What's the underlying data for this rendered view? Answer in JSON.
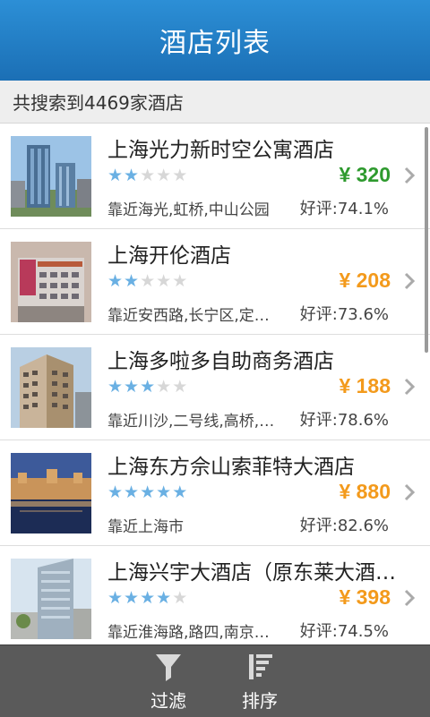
{
  "header": {
    "title": "酒店列表"
  },
  "summary": {
    "text": "共搜索到4469家酒店"
  },
  "hotels": [
    {
      "name": "上海光力新时空公寓酒店",
      "stars": 2,
      "price": "¥ 320",
      "price_color": "#2e9a2e",
      "location": "靠近海光,虹桥,中山公园",
      "rating": "好评:74.1%",
      "thumbnail": "glass-tower"
    },
    {
      "name": "上海开伦酒店",
      "stars": 2,
      "price": "¥ 208",
      "price_color": "#f39a1c",
      "location": "靠近安西路,长宁区,定…",
      "rating": "好评:73.6%",
      "thumbnail": "hotel-facade"
    },
    {
      "name": "上海多啦多自助商务酒店",
      "stars": 3,
      "price": "¥ 188",
      "price_color": "#f39a1c",
      "location": "靠近川沙,二号线,高桥,…",
      "rating": "好评:78.6%",
      "thumbnail": "corner-building"
    },
    {
      "name": "上海东方佘山索菲特大酒店",
      "stars": 5,
      "price": "¥ 880",
      "price_color": "#f39a1c",
      "location": "靠近上海市",
      "rating": "好评:82.6%",
      "thumbnail": "lake-night-resort"
    },
    {
      "name": "上海兴宇大酒店（原东莱大酒…",
      "stars": 4,
      "price": "¥ 398",
      "price_color": "#f39a1c",
      "location": "靠近淮海路,路四,南京…",
      "rating": "好评:74.5%",
      "thumbnail": "modern-tower"
    }
  ],
  "footer": {
    "filter": {
      "label": "过滤",
      "icon": "funnel-icon"
    },
    "sort": {
      "label": "排序",
      "icon": "sort-icon"
    }
  }
}
